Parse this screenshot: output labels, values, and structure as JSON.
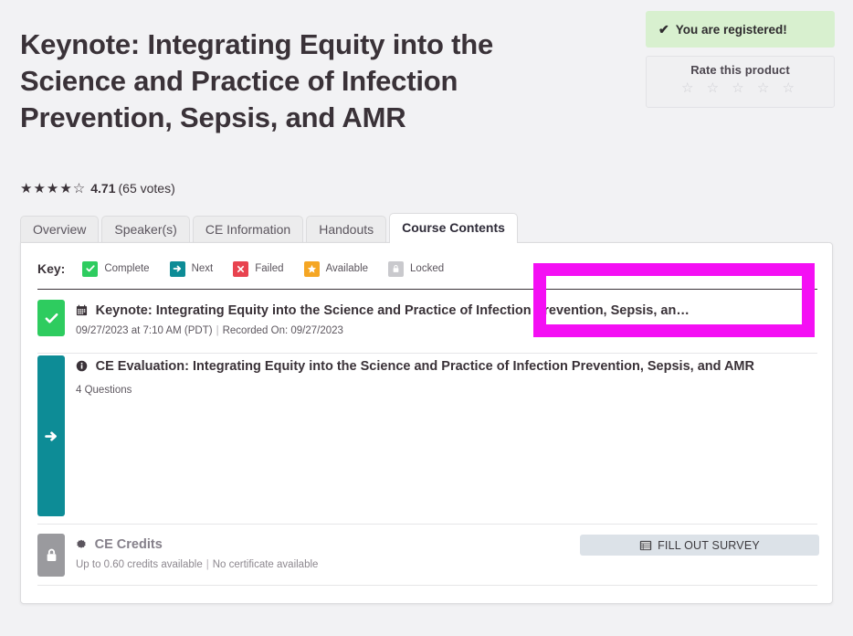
{
  "header": {
    "title": "Keynote: Integrating Equity into the Science and Practice of Infection Prevention, Sepsis, and AMR",
    "registered_badge": {
      "check_glyph": "✔",
      "label": "You are registered!",
      "background_color": "#d8f0cf"
    },
    "rate_box": {
      "label": "Rate this product",
      "stars": "☆ ☆ ☆ ☆ ☆",
      "star_count": 5,
      "filled": 0
    }
  },
  "rating": {
    "stars": "★★★★☆",
    "score": "4.71",
    "votes": "(65 votes)"
  },
  "tabs": [
    {
      "label": "Overview",
      "active": false
    },
    {
      "label": "Speaker(s)",
      "active": false
    },
    {
      "label": "CE Information",
      "active": false
    },
    {
      "label": "Handouts",
      "active": false
    },
    {
      "label": "Course Contents",
      "active": true
    }
  ],
  "panel": {
    "key": {
      "label": "Key:",
      "items": [
        {
          "label": "Complete",
          "glyph": "✔",
          "color": "#2ecc5f",
          "icon_name": "check-icon"
        },
        {
          "label": "Next",
          "glyph": "➜",
          "color": "#0d8c96",
          "icon_name": "arrow-right-icon"
        },
        {
          "label": "Failed",
          "glyph": "✖",
          "color": "#e8434f",
          "icon_name": "x-icon"
        },
        {
          "label": "Available",
          "glyph": "★",
          "color": "#f5a623",
          "icon_name": "star-icon"
        },
        {
          "label": "Locked",
          "glyph": "ὑ2",
          "color": "#c9c9cd",
          "icon_name": "lock-icon"
        }
      ]
    },
    "rows": [
      {
        "status": "complete",
        "badge_glyph": "✔",
        "badge_color": "#2ecc5f",
        "icon_name": "calendar-icon",
        "title": "Keynote: Integrating Equity into the Science and Practice of Infection Prevention, Sepsis, an…",
        "date": "09/27/2023 at 7:10 AM (PDT)",
        "separator": "|",
        "recorded": "Recorded On: 09/27/2023"
      },
      {
        "status": "next",
        "badge_glyph": "➜",
        "badge_color": "#0d8c96",
        "icon_name": "info-icon",
        "title": "CE Evaluation: Integrating Equity into the Science and Practice of Infection Prevention, Sepsis, and AMR",
        "questions": "4 Questions",
        "action_label": "FILL OUT SURVEY",
        "action_icon": "form-list-icon"
      },
      {
        "status": "locked",
        "badge_glyph": "ὑ2",
        "badge_color": "#9a9a9e",
        "icon_name": "award-badge-icon",
        "title": "CE Credits",
        "credits": "Up to 0.60 credits available",
        "separator": "|",
        "certificate": "No certificate available"
      }
    ]
  },
  "highlight": {
    "color": "#f40ff4",
    "target": "fill-out-survey-button"
  }
}
